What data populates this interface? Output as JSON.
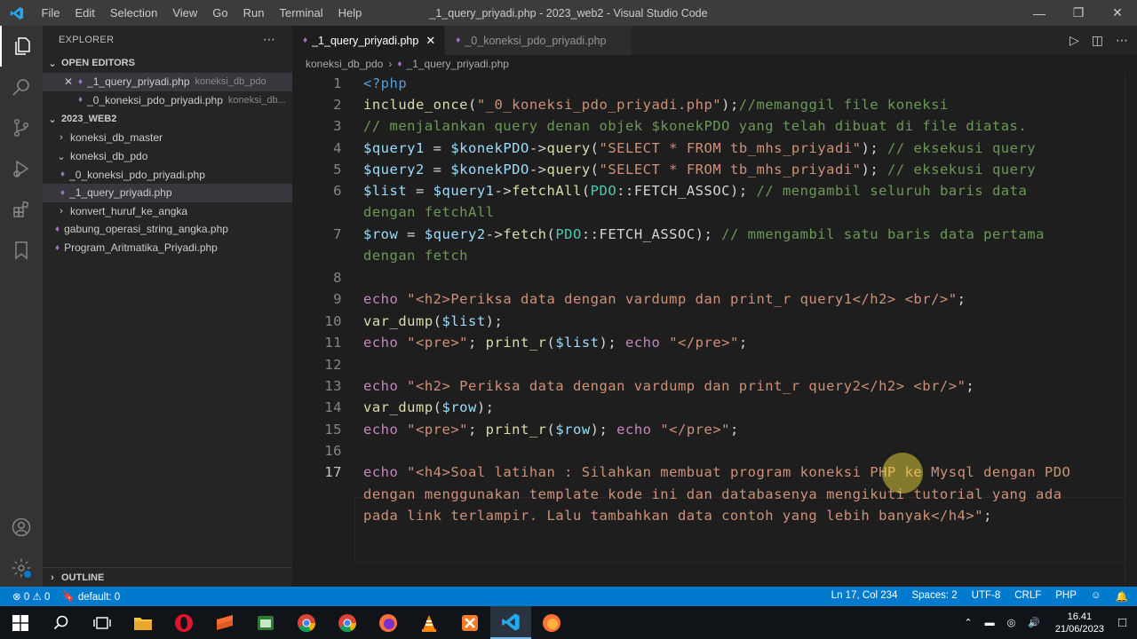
{
  "menu": [
    "File",
    "Edit",
    "Selection",
    "View",
    "Go",
    "Run",
    "Terminal",
    "Help"
  ],
  "window_title": "_1_query_priyadi.php - 2023_web2 - Visual Studio Code",
  "explorer": {
    "header": "EXPLORER",
    "open_editors": "OPEN EDITORS",
    "workspace": "2023_WEB2",
    "outline": "OUTLINE",
    "open": [
      {
        "name": "_1_query_priyadi.php",
        "desc": "koneksi_db_pdo"
      },
      {
        "name": "_0_koneksi_pdo_priyadi.php",
        "desc": "koneksi_db..."
      }
    ],
    "tree": {
      "folder1": "koneksi_db_master",
      "folder2": "koneksi_db_pdo",
      "file1": "_0_koneksi_pdo_priyadi.php",
      "file2": "_1_query_priyadi.php",
      "folder3": "konvert_huruf_ke_angka",
      "file3": "gabung_operasi_string_angka.php",
      "file4": "Program_Aritmatika_Priyadi.php"
    }
  },
  "tabs": [
    {
      "label": "_1_query_priyadi.php"
    },
    {
      "label": "_0_koneksi_pdo_priyadi.php"
    }
  ],
  "breadcrumb": {
    "folder": "koneksi_db_pdo",
    "file": "_1_query_priyadi.php"
  },
  "line_numbers": [
    "1",
    "2",
    "3",
    "4",
    "5",
    "6",
    "7",
    "8",
    "9",
    "10",
    "11",
    "12",
    "13",
    "14",
    "15",
    "16",
    "17"
  ],
  "code": {
    "l1": "<?php",
    "l2a": "include_once",
    "l2b": "(",
    "l2c": "\"_0_koneksi_pdo_priyadi.php\"",
    "l2d": ");",
    "l2e": "//memanggil file koneksi",
    "l3": "// menjalankan query denan objek $konekPDO yang telah dibuat di file diatas.",
    "l4a": "$query1",
    "l4b": " = ",
    "l4c": "$konekPDO",
    "l4d": "->",
    "l4e": "query",
    "l4f": "(",
    "l4g": "\"SELECT * FROM tb_mhs_priyadi\"",
    "l4h": "); ",
    "l4i": "// eksekusi query",
    "l5a": "$query2",
    "l5b": " = ",
    "l5c": "$konekPDO",
    "l5d": "->",
    "l5e": "query",
    "l5f": "(",
    "l5g": "\"SELECT * FROM tb_mhs_priyadi\"",
    "l5h": "); ",
    "l5i": "// eksekusi query",
    "l6a": "$list",
    "l6b": " = ",
    "l6c": "$query1",
    "l6d": "->",
    "l6e": "fetchAll",
    "l6f": "(",
    "l6g": "PDO",
    "l6h": "::FETCH_ASSOC); ",
    "l6i": "// mengambil seluruh baris data",
    "l6w": "dengan fetchAll",
    "l7a": "$row",
    "l7b": " = ",
    "l7c": "$query2",
    "l7d": "->",
    "l7e": "fetch",
    "l7f": "(",
    "l7g": "PDO",
    "l7h": "::FETCH_ASSOC); ",
    "l7i": "// mmengambil satu baris data pertama",
    "l7w": "dengan fetch",
    "l9a": "echo",
    "l9b": " ",
    "l9c": "\"<h2>Periksa data dengan vardump dan print_r query1</h2> <br/>\"",
    "l9d": ";",
    "l10a": "var_dump",
    "l10b": "(",
    "l10c": "$list",
    "l10d": ");",
    "l11a": "echo",
    "l11b": " ",
    "l11c": "\"<pre>\"",
    "l11d": "; ",
    "l11e": "print_r",
    "l11f": "(",
    "l11g": "$list",
    "l11h": "); ",
    "l11i": "echo",
    "l11j": " ",
    "l11k": "\"</pre>\"",
    "l11l": ";",
    "l13a": "echo",
    "l13b": " ",
    "l13c": "\"<h2> Periksa data dengan vardump dan print_r query2</h2> <br/>\"",
    "l13d": ";",
    "l14a": "var_dump",
    "l14b": "(",
    "l14c": "$row",
    "l14d": ");",
    "l15a": "echo",
    "l15b": " ",
    "l15c": "\"<pre>\"",
    "l15d": "; ",
    "l15e": "print_r",
    "l15f": "(",
    "l15g": "$row",
    "l15h": "); ",
    "l15i": "echo",
    "l15j": " ",
    "l15k": "\"</pre>\"",
    "l15l": ";",
    "l17a": "echo",
    "l17b": " ",
    "l17c": "\"<h4>Soal latihan : Silahkan membuat program koneksi PHP ke Mysql dengan PDO",
    "l17w1": "dengan menggunakan template kode ini dan databasenya mengikuti tutorial yang ada",
    "l17w2": "pada link terlampir. Lalu tambahkan data contoh yang lebih banyak</h4>\"",
    "l17d": ";"
  },
  "status": {
    "errors": "0",
    "warnings": "0",
    "branch": "default: 0",
    "position": "Ln 17, Col 234",
    "spaces": "Spaces: 2",
    "encoding": "UTF-8",
    "eol": "CRLF",
    "language": "PHP"
  },
  "taskbar": {
    "time": "16.41",
    "date": "21/06/2023"
  },
  "colors": {
    "accent": "#007acc",
    "titlebar": "#3c3c3c",
    "sidebar": "#252526",
    "editor": "#1e1e1e"
  }
}
